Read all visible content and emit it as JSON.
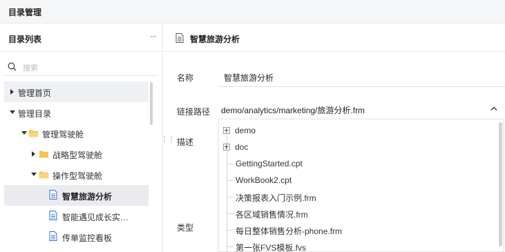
{
  "window": {
    "title": "目录管理"
  },
  "sidebar": {
    "title": "目录列表",
    "more_label": "···",
    "search": {
      "placeholder": "搜索"
    },
    "tree": [
      {
        "label": "管理首页"
      },
      {
        "label": "管理目录"
      },
      {
        "label": "管理驾驶舱"
      },
      {
        "label": "战略型驾驶舱"
      },
      {
        "label": "操作型驾驶舱"
      },
      {
        "label": "智慧旅游分析"
      },
      {
        "label": "智能遇见成长实…"
      },
      {
        "label": "传单监控看板"
      }
    ]
  },
  "detail": {
    "title": "智慧旅游分析",
    "name_label": "名称",
    "name_value": "智慧旅游分析",
    "path_label": "链接路径",
    "path_value": "demo/analytics/marketing/旅游分析.frm",
    "desc_label": "描述",
    "type_label": "类型"
  },
  "dropdown": {
    "items": [
      {
        "label": "demo"
      },
      {
        "label": "doc"
      },
      {
        "label": "GettingStarted.cpt"
      },
      {
        "label": "WorkBook2.cpt"
      },
      {
        "label": "决策报表入门示例.frm"
      },
      {
        "label": "各区域销售情况.frm"
      },
      {
        "label": "每日整体销售分析-phone.frm"
      },
      {
        "label": "第一张FVS模板.fvs"
      }
    ]
  },
  "colors": {
    "selected_bg": "#e9ebef",
    "folder": "#f5c451",
    "file_icon": "#2f6fd0"
  }
}
